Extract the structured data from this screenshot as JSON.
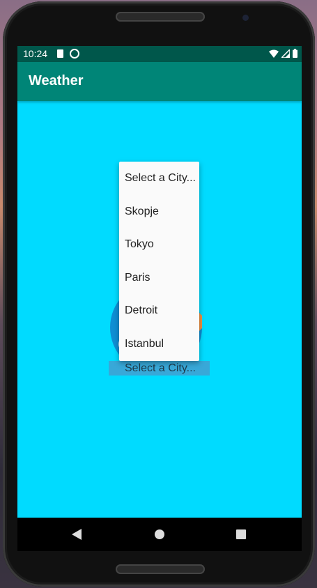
{
  "status_bar": {
    "time": "10:24",
    "icons": [
      "sd-card-icon",
      "sync-icon",
      "wifi-icon",
      "signal-icon",
      "battery-icon"
    ]
  },
  "app_bar": {
    "title": "Weather",
    "color": "#008577"
  },
  "colors": {
    "status_bar": "#00574b",
    "background": "#00dbff",
    "spinner_field": "#38a8d8",
    "weather_circle": "#0f8ed3",
    "sun_orange": "#f09040"
  },
  "city_spinner": {
    "selected": "Select a City...",
    "options": [
      "Select a City...",
      "Skopje",
      "Tokyo",
      "Paris",
      "Detroit",
      "Istanbul"
    ]
  },
  "nav_bar": {
    "buttons": [
      "back-icon",
      "home-icon",
      "recents-icon"
    ]
  }
}
